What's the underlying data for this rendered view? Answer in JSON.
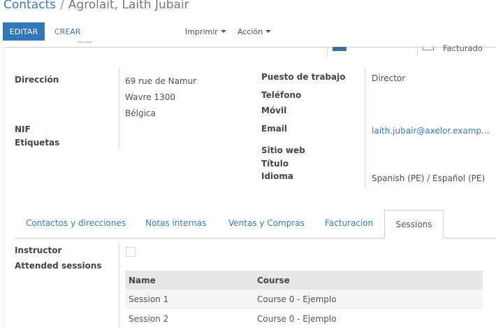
{
  "breadcrumb": {
    "parent": "Contacts",
    "separator": "/",
    "current": "Agrolait, Laith Jubair"
  },
  "toolbar": {
    "edit_label": "EDITAR",
    "create_label": "CREAR",
    "print_label": "Imprimir",
    "action_label": "Acción"
  },
  "stat_buttons": {
    "invoiced_label": "Facturado"
  },
  "fields": {
    "address_label": "Dirección",
    "address_lines": [
      "69 rue de Namur",
      "Wavre 1300",
      "Bélgica"
    ],
    "vat_label": "NIF",
    "tags_label": "Etiquetas",
    "job_label": "Puesto de trabajo",
    "job_value": "Director",
    "phone_label": "Teléfono",
    "mobile_label": "Móvil",
    "email_label": "Email",
    "email_value": "laith.jubair@axelor.examp...",
    "website_label": "Sitio web",
    "title_label": "Título",
    "language_label": "Idioma",
    "language_value": "Spanish (PE) / Español (PE)"
  },
  "tabs": [
    {
      "label": "Contactos y direcciones",
      "active": false
    },
    {
      "label": "Notas internas",
      "active": false
    },
    {
      "label": "Ventas y Compras",
      "active": false
    },
    {
      "label": "Facturacion",
      "active": false
    },
    {
      "label": "Sessions",
      "active": true
    }
  ],
  "sessions_tab": {
    "instructor_label": "Instructor",
    "instructor_checked": false,
    "attended_label": "Attended sessions",
    "columns": [
      "Name",
      "Course"
    ],
    "rows": [
      {
        "name": "Session 1",
        "course": "Course 0 - Ejemplo"
      },
      {
        "name": "Session 2",
        "course": "Course 0 - Ejemplo"
      }
    ]
  },
  "colors": {
    "primary": "#3277b8",
    "link": "#3a7ab5",
    "header_bg": "#e7e7e7"
  }
}
